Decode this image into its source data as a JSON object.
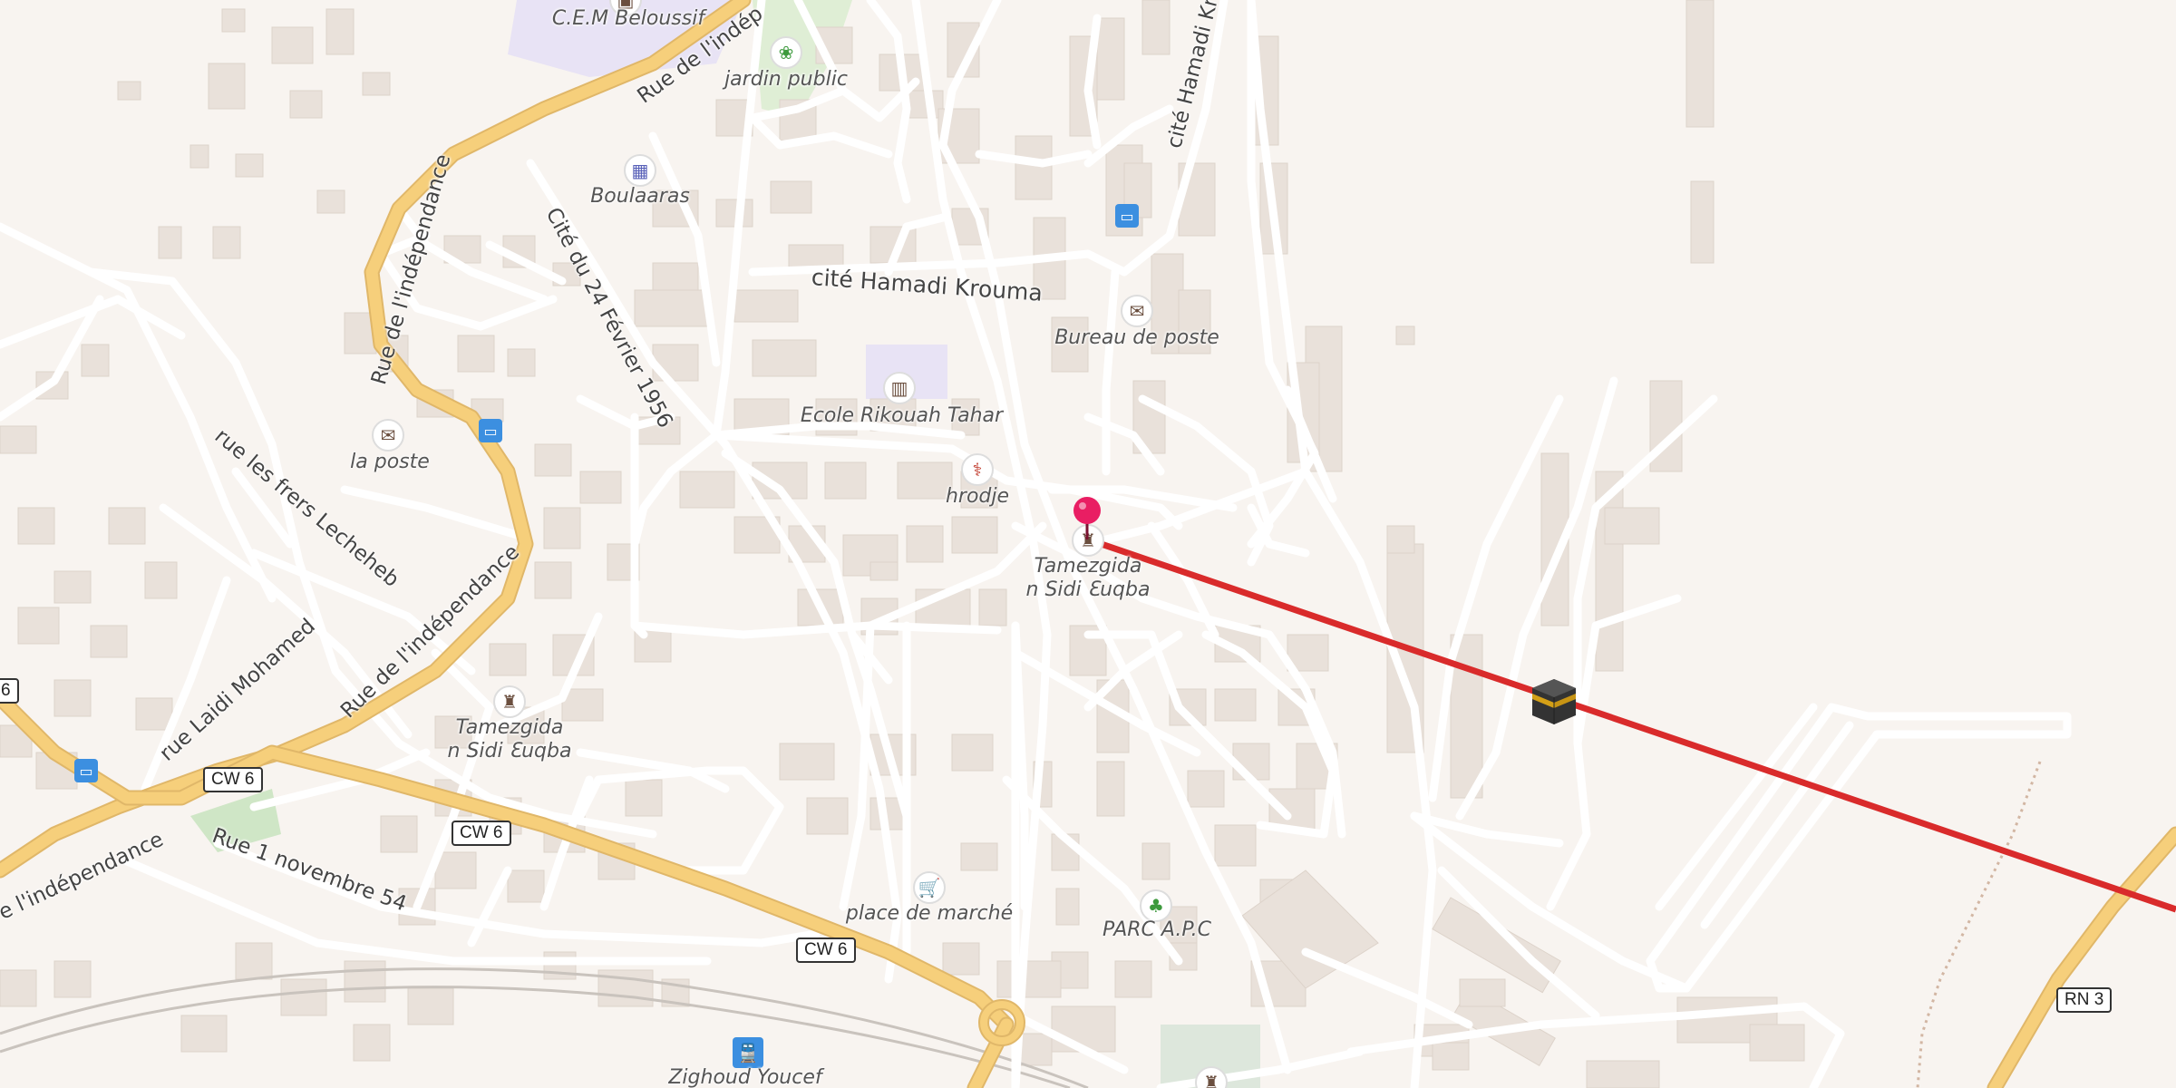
{
  "places": {
    "cem": "C.E.M Beloussif",
    "jardin": "jardin public",
    "boulaaras": "Boulaaras",
    "bureau_poste": "Bureau de poste",
    "ecole": "Ecole Rikouah Tahar",
    "hrodje": "hrodje",
    "la_poste": "la poste",
    "tamezgida_1_line1": "Tamezgida",
    "tamezgida_1_line2": "n Sidi Ɛuqba",
    "tamezgida_2_line1": "Tamezgida",
    "tamezgida_2_line2": "n Sidi Ɛuqba",
    "marche": "place de marché",
    "parc": "PARC A.P.C",
    "zighoud": "Zighoud Youcef"
  },
  "streets": {
    "independance_top": "Rue de l'indép",
    "independance_left": "Rue de l'indépendance",
    "independance_mid": "Rue de l'indépendance",
    "independance_bottom": "e l'indépendance",
    "cite_24": "Cité du 24 Février 1956",
    "cite_hamadi_top": "cité Hamadi Kr",
    "cite_hamadi": "cité Hamadi Krouma",
    "frers": "rue les frers Lecheheb",
    "laidi": "rue Laidi Mohamed",
    "novembre": "Rue 1 novembre 54"
  },
  "shields": {
    "cw6_a": "CW 6",
    "cw6_b": "CW 6",
    "cw6_c": "CW 6",
    "rn3": "RN 3",
    "edge": "6"
  },
  "icons": {
    "school": "school-icon",
    "park": "park-icon",
    "museum": "museum-icon",
    "post": "post-office-icon",
    "bus": "bus-stop-icon",
    "doctor": "doctor-icon",
    "mosque": "mosque-icon",
    "shop": "shopping-cart-icon",
    "tree": "tree-icon",
    "train": "train-station-icon",
    "pin": "location-pin-icon",
    "kaaba": "kaaba-icon"
  },
  "colors": {
    "background": "#f8f4f0",
    "building": "#e9e1da",
    "road": "#ffffff",
    "major_road": "#f6cf7b",
    "qibla_line": "#d92b2b",
    "pin": "#e91e63"
  }
}
